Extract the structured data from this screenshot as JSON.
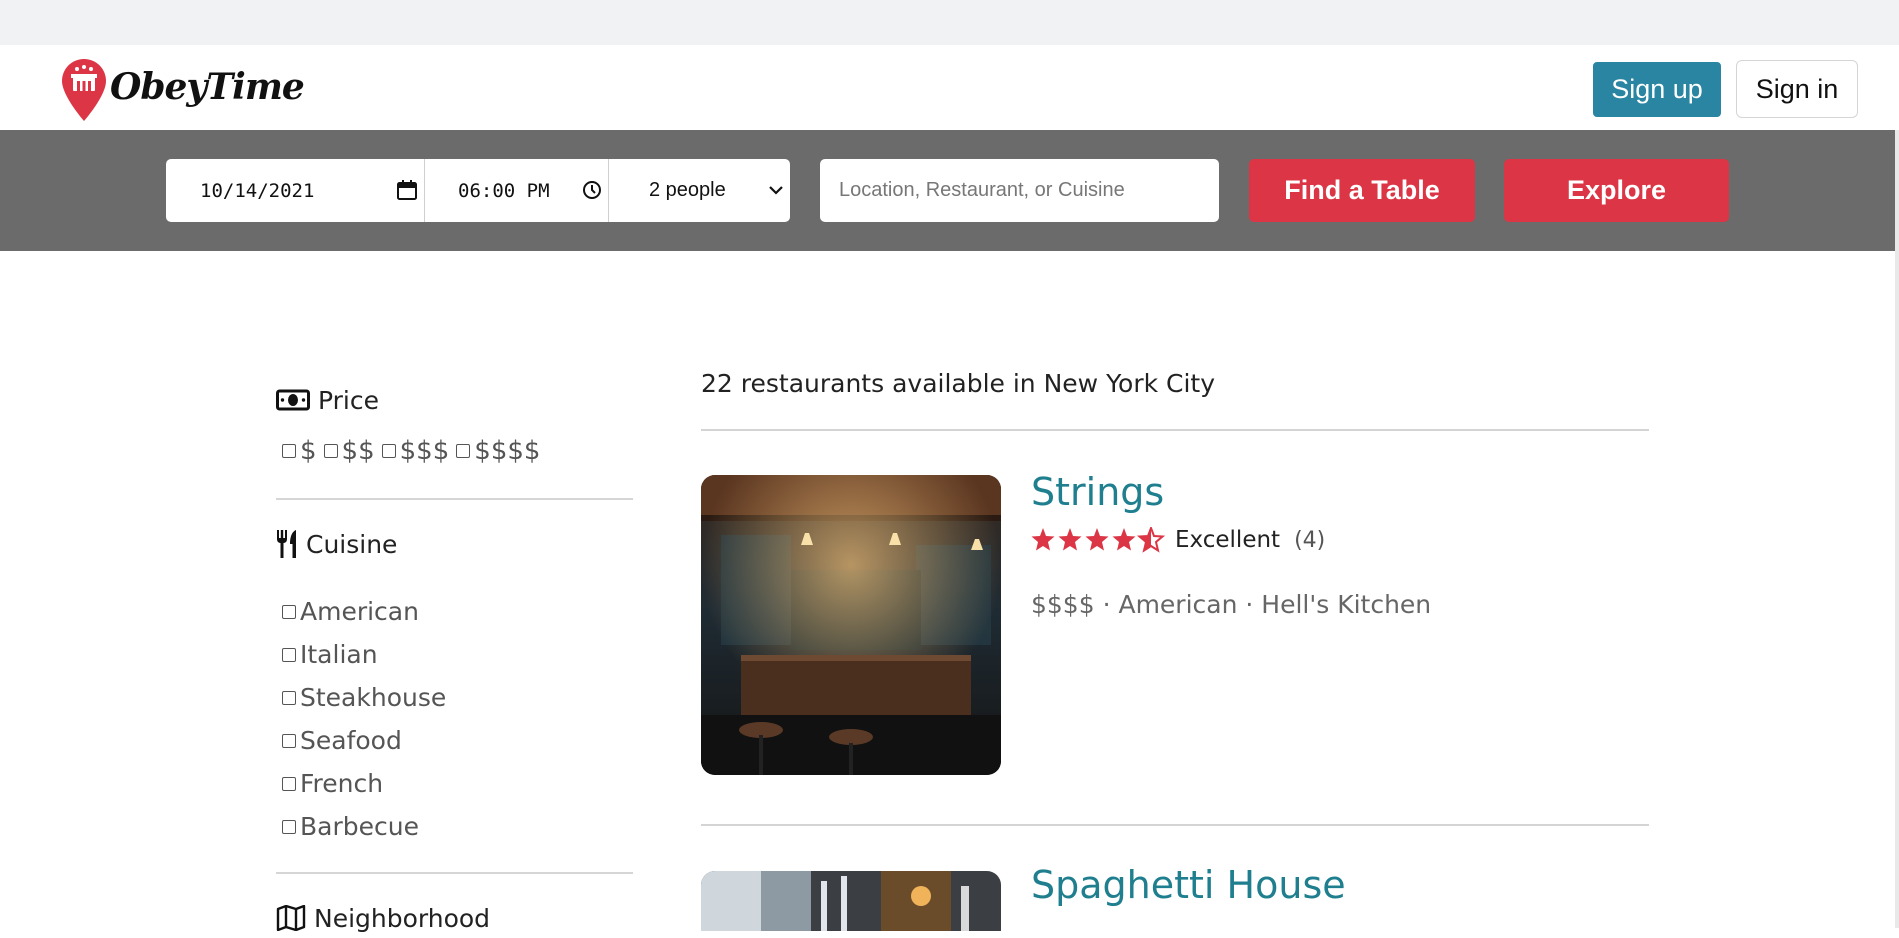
{
  "brand": {
    "name": "ObeyTime"
  },
  "header": {
    "signup_label": "Sign up",
    "signin_label": "Sign in"
  },
  "search": {
    "date": "10/14/2021",
    "time": "06:00 PM",
    "party_size": "2 people",
    "query_placeholder": "Location, Restaurant, or Cuisine",
    "find_label": "Find a Table",
    "explore_label": "Explore"
  },
  "filters": {
    "price": {
      "title": "Price",
      "options": [
        "$",
        "$$",
        "$$$",
        "$$$$"
      ]
    },
    "cuisine": {
      "title": "Cuisine",
      "options": [
        "American",
        "Italian",
        "Steakhouse",
        "Seafood",
        "French",
        "Barbecue"
      ]
    },
    "neighborhood": {
      "title": "Neighborhood"
    }
  },
  "results": {
    "summary": "22 restaurants available in New York City",
    "restaurants": [
      {
        "name": "Strings",
        "rating_stars": 4.5,
        "rating_label": "Excellent",
        "review_count": "(4)",
        "meta": "$$$$ · American · Hell's Kitchen"
      },
      {
        "name": "Spaghetti House"
      }
    ]
  },
  "colors": {
    "accent_red": "#dc3545",
    "signup_blue": "#2a85a3",
    "name_teal": "#1f7f8f",
    "searchbar_gray": "#6b6b6b"
  }
}
